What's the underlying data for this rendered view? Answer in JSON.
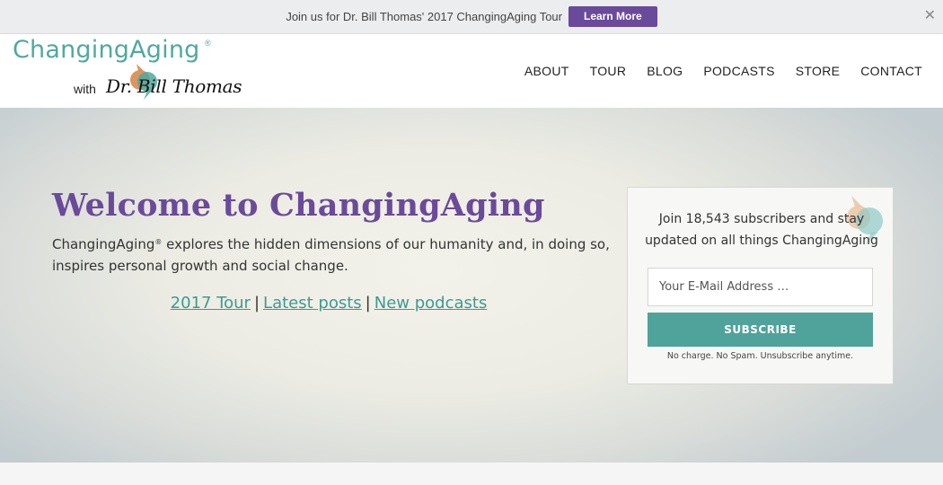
{
  "topbar": {
    "message": "Join us for Dr. Bill Thomas' 2017 ChangingAging Tour",
    "button_label": "Learn More",
    "close_label": "✕"
  },
  "logo": {
    "main": "ChangingAging",
    "reg": "®",
    "with": "with",
    "name": "Dr. Bill Thomas"
  },
  "nav": {
    "items": [
      "ABOUT",
      "TOUR",
      "BLOG",
      "PODCASTS",
      "STORE",
      "CONTACT"
    ]
  },
  "hero": {
    "title": "Welcome to ChangingAging",
    "desc_brand": "ChangingAging",
    "desc_reg": "®",
    "desc_rest": " explores the hidden dimensions of our humanity and, in doing so, inspires personal growth and social change.",
    "links": [
      "2017 Tour",
      "Latest posts",
      "New podcasts"
    ],
    "separator": "|"
  },
  "subscribe": {
    "text": "Join 18,543 subscribers and stay updated on all things ChangingAging",
    "email_placeholder": "Your E-Mail Address …",
    "button_label": "SUBSCRIBE",
    "note": "No charge. No Spam. Unsubscribe anytime."
  },
  "colors": {
    "purple": "#6a4a9a",
    "teal": "#4fa39b",
    "orange": "#d98a4e"
  }
}
